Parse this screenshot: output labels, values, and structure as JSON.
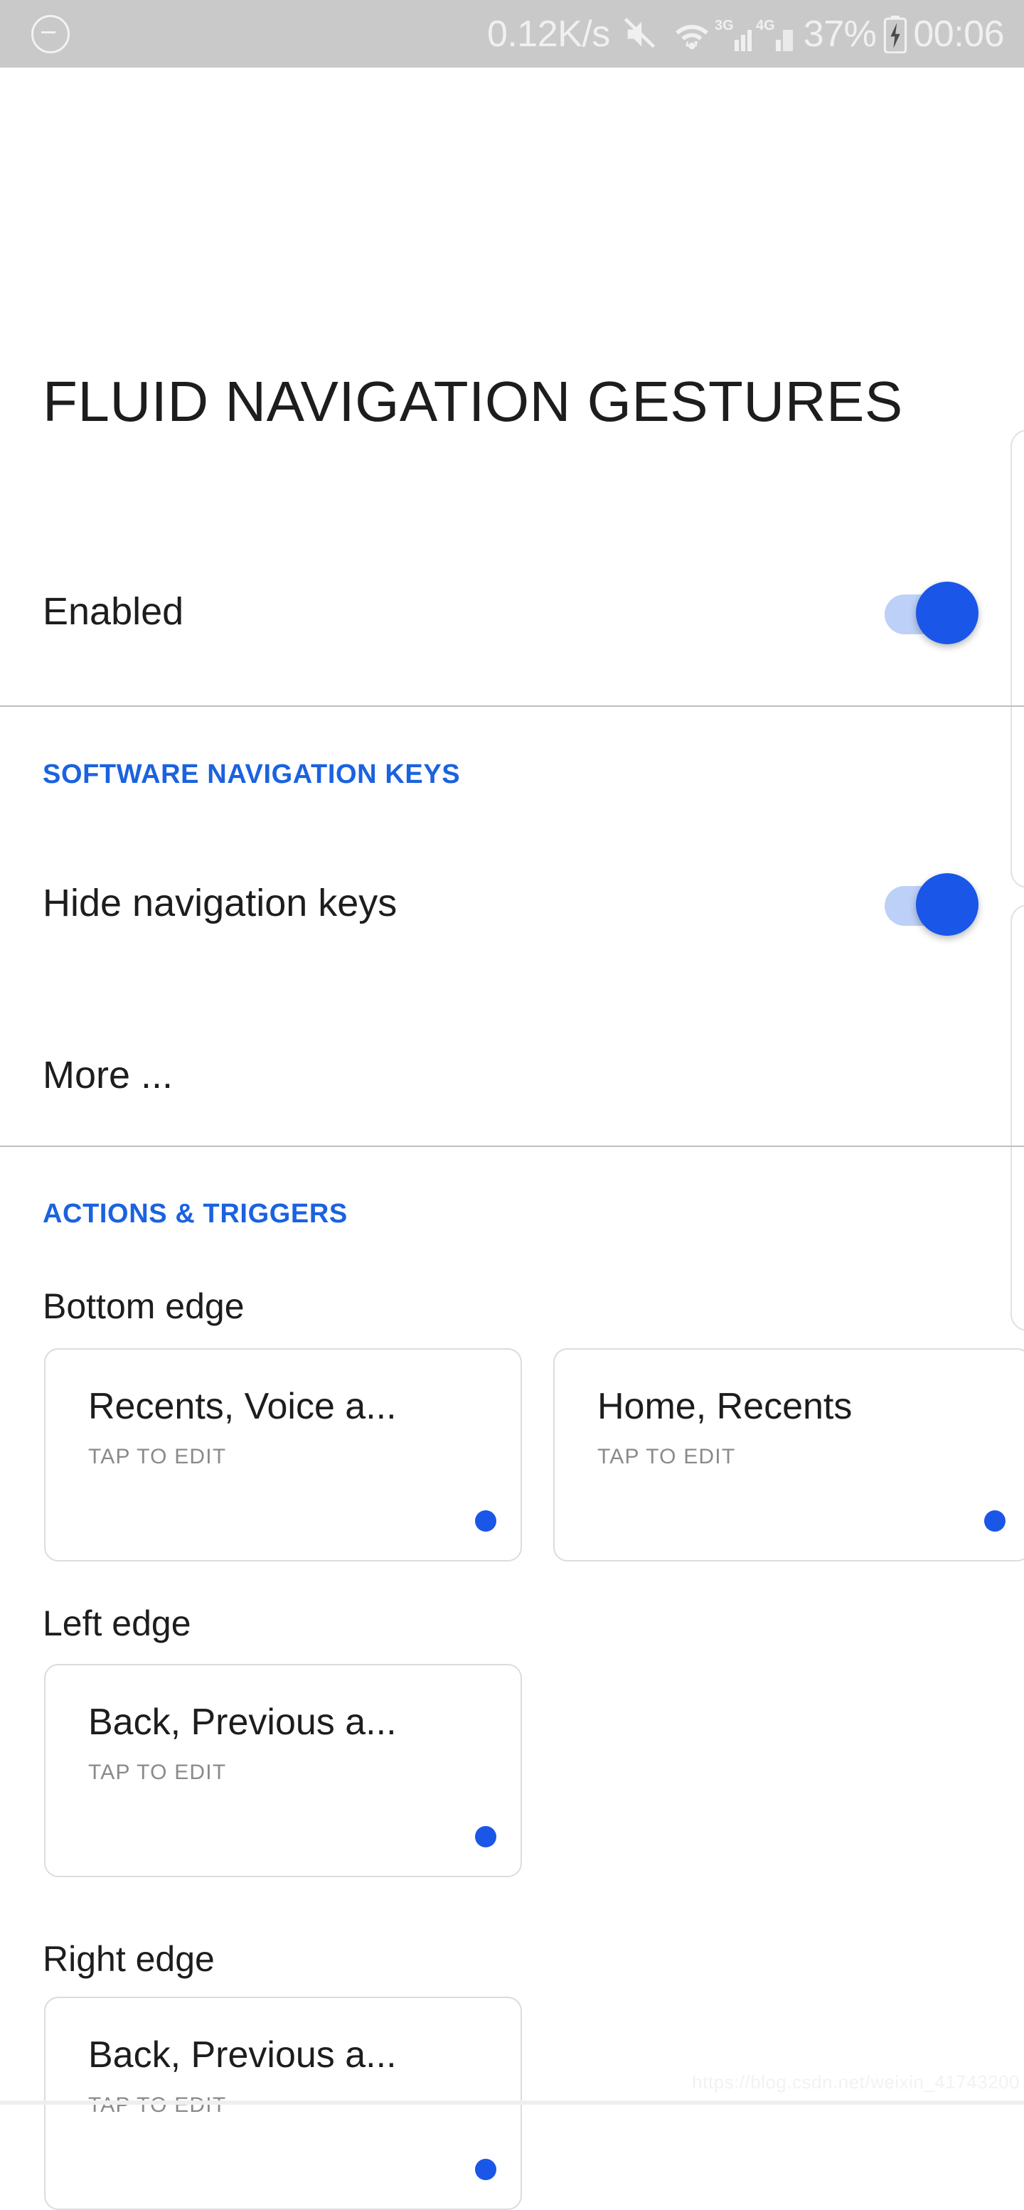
{
  "status_bar": {
    "left_icon": "minus-circle-icon",
    "net_speed": "0.12K/s",
    "icons": [
      "mute-icon",
      "wifi-icon",
      "signal-3g-icon",
      "signal-4g-icon"
    ],
    "signal_3g_label": "3G",
    "signal_4g_label": "4G",
    "battery_percent": "37%",
    "battery_icon": "battery-charging-icon",
    "clock": "00:06"
  },
  "page": {
    "title": "FLUID NAVIGATION GESTURES",
    "watermark": "https://blog.csdn.net/weixin_41743200"
  },
  "enabled_row": {
    "label": "Enabled",
    "toggle_state": "on"
  },
  "software_nav": {
    "header": "SOFTWARE NAVIGATION KEYS",
    "hide_keys_label": "Hide navigation keys",
    "hide_keys_toggle_state": "on",
    "more_label": "More ..."
  },
  "actions": {
    "header": "ACTIONS & TRIGGERS",
    "groups": [
      {
        "label": "Bottom edge",
        "cards": [
          {
            "title": "Recents, Voice a...",
            "subtitle": "TAP TO EDIT",
            "dot": "blue-dot-icon"
          },
          {
            "title": "Home, Recents",
            "subtitle": "TAP TO EDIT",
            "dot": "blue-dot-icon"
          }
        ]
      },
      {
        "label": "Left edge",
        "cards": [
          {
            "title": "Back, Previous a...",
            "subtitle": "TAP TO EDIT",
            "dot": "blue-dot-icon"
          }
        ]
      },
      {
        "label": "Right edge",
        "cards": [
          {
            "title": "Back, Previous a...",
            "subtitle": "TAP TO EDIT",
            "dot": "blue-dot-icon"
          }
        ]
      }
    ]
  },
  "colors": {
    "accent_blue": "#1a62e0",
    "toggle_thumb": "#1a56e8",
    "toggle_track": "#bdd0f7",
    "status_bar_bg": "#c9c9c9",
    "text_primary": "#1d1d1d",
    "text_secondary": "#8a8a8a",
    "divider": "#bfbfbf"
  }
}
